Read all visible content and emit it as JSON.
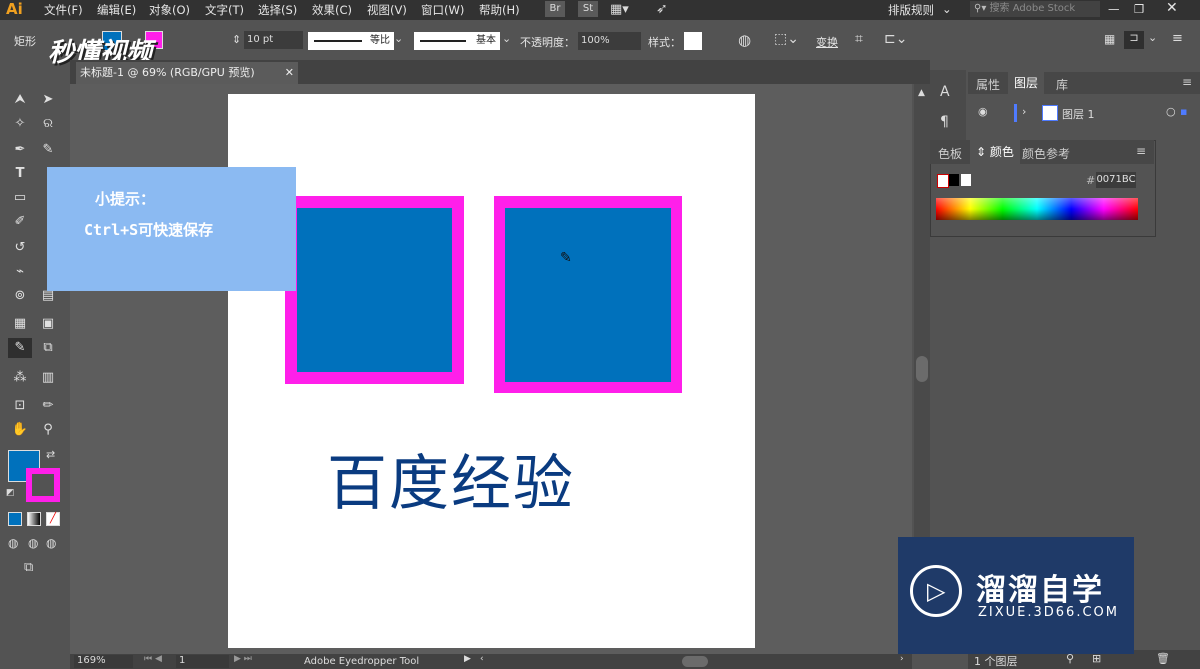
{
  "app": {
    "logo": "Ai",
    "window_title": "未标题-1 @ 69% (RGB/GPU 预览)"
  },
  "menu": {
    "items": [
      "文件(F)",
      "编辑(E)",
      "对象(O)",
      "文字(T)",
      "选择(S)",
      "效果(C)",
      "视图(V)",
      "窗口(W)",
      "帮助(H)"
    ],
    "bridge": "Br",
    "stock": "St",
    "workspace": "排版规则",
    "search_placeholder": "搜索 Adobe Stock"
  },
  "control": {
    "shape_label": "矩形",
    "stroke_size": "10 pt",
    "stroke_profile": "等比",
    "brush": "基本",
    "opacity_label": "不透明度：",
    "opacity_value": "100%",
    "style_label": "样式：",
    "transform": "变换"
  },
  "canvas": {
    "text": "百度经验",
    "fill_color": "#0071bc",
    "stroke_color": "#ff1fea"
  },
  "tip": {
    "title": "小提示：",
    "body": "Ctrl+S可快速保存"
  },
  "top_watermark": "秒懂视频",
  "panels": {
    "tabs": [
      "属性",
      "图层",
      "库"
    ],
    "layer_name": "图层 1",
    "color_tabs": [
      "色板",
      "颜色",
      "颜色参考"
    ],
    "hex_prefix": "#",
    "hex_value": "0071BC",
    "layers_count": "1 个图层"
  },
  "status": {
    "zoom": "169%",
    "page": "1",
    "tool_name": "Adobe Eyedropper Tool"
  },
  "watermark": {
    "title": "溜溜自学",
    "url": "ZIXUE.3D66.COM"
  }
}
